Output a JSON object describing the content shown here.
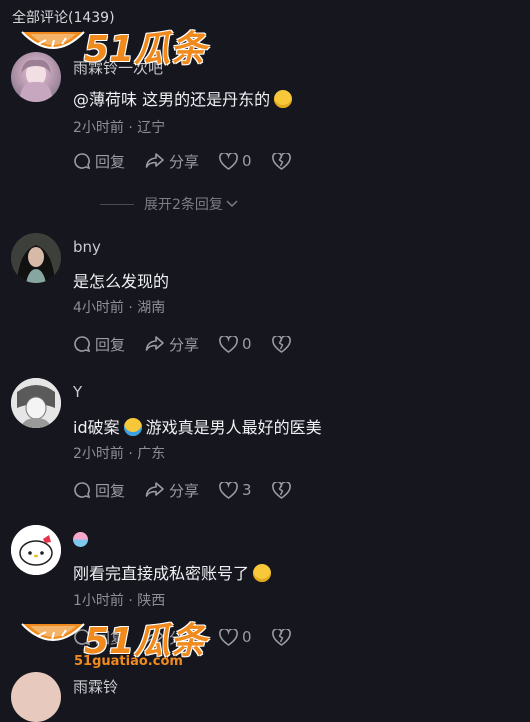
{
  "header": {
    "title": "全部评论(1439)"
  },
  "watermark": {
    "brand": "51瓜条",
    "site": "51guatiao.com"
  },
  "comments": [
    {
      "username": "雨霖铃一次吧",
      "text": "@薄荷味 这男的还是丹东的",
      "emoji": "face-with-glasses-emoji",
      "time": "2小时前 · 辽宁",
      "reply_label": "回复",
      "share_label": "分享",
      "likes": "0",
      "expand": "展开2条回复"
    },
    {
      "username": "bny",
      "text": "是怎么发现的",
      "time": "4小时前 · 湖南",
      "reply_label": "回复",
      "share_label": "分享",
      "likes": "0"
    },
    {
      "username": "Y",
      "text_before": "id破案",
      "text_after": "游戏真是男人最好的医美",
      "emoji": "rolling-laughing-emoji",
      "time": "2小时前 · 广东",
      "reply_label": "回复",
      "share_label": "分享",
      "likes": "3"
    },
    {
      "username": "",
      "text": "刚看完直接成私密账号了",
      "emoji": "worried-face-emoji",
      "time": "1小时前 · 陕西",
      "reply_label": "回复",
      "share_label": "分享",
      "likes": "0"
    },
    {
      "username": "雨霖铃"
    }
  ],
  "colors": {
    "background": "#15161e",
    "watermark": "#f08a1c"
  }
}
